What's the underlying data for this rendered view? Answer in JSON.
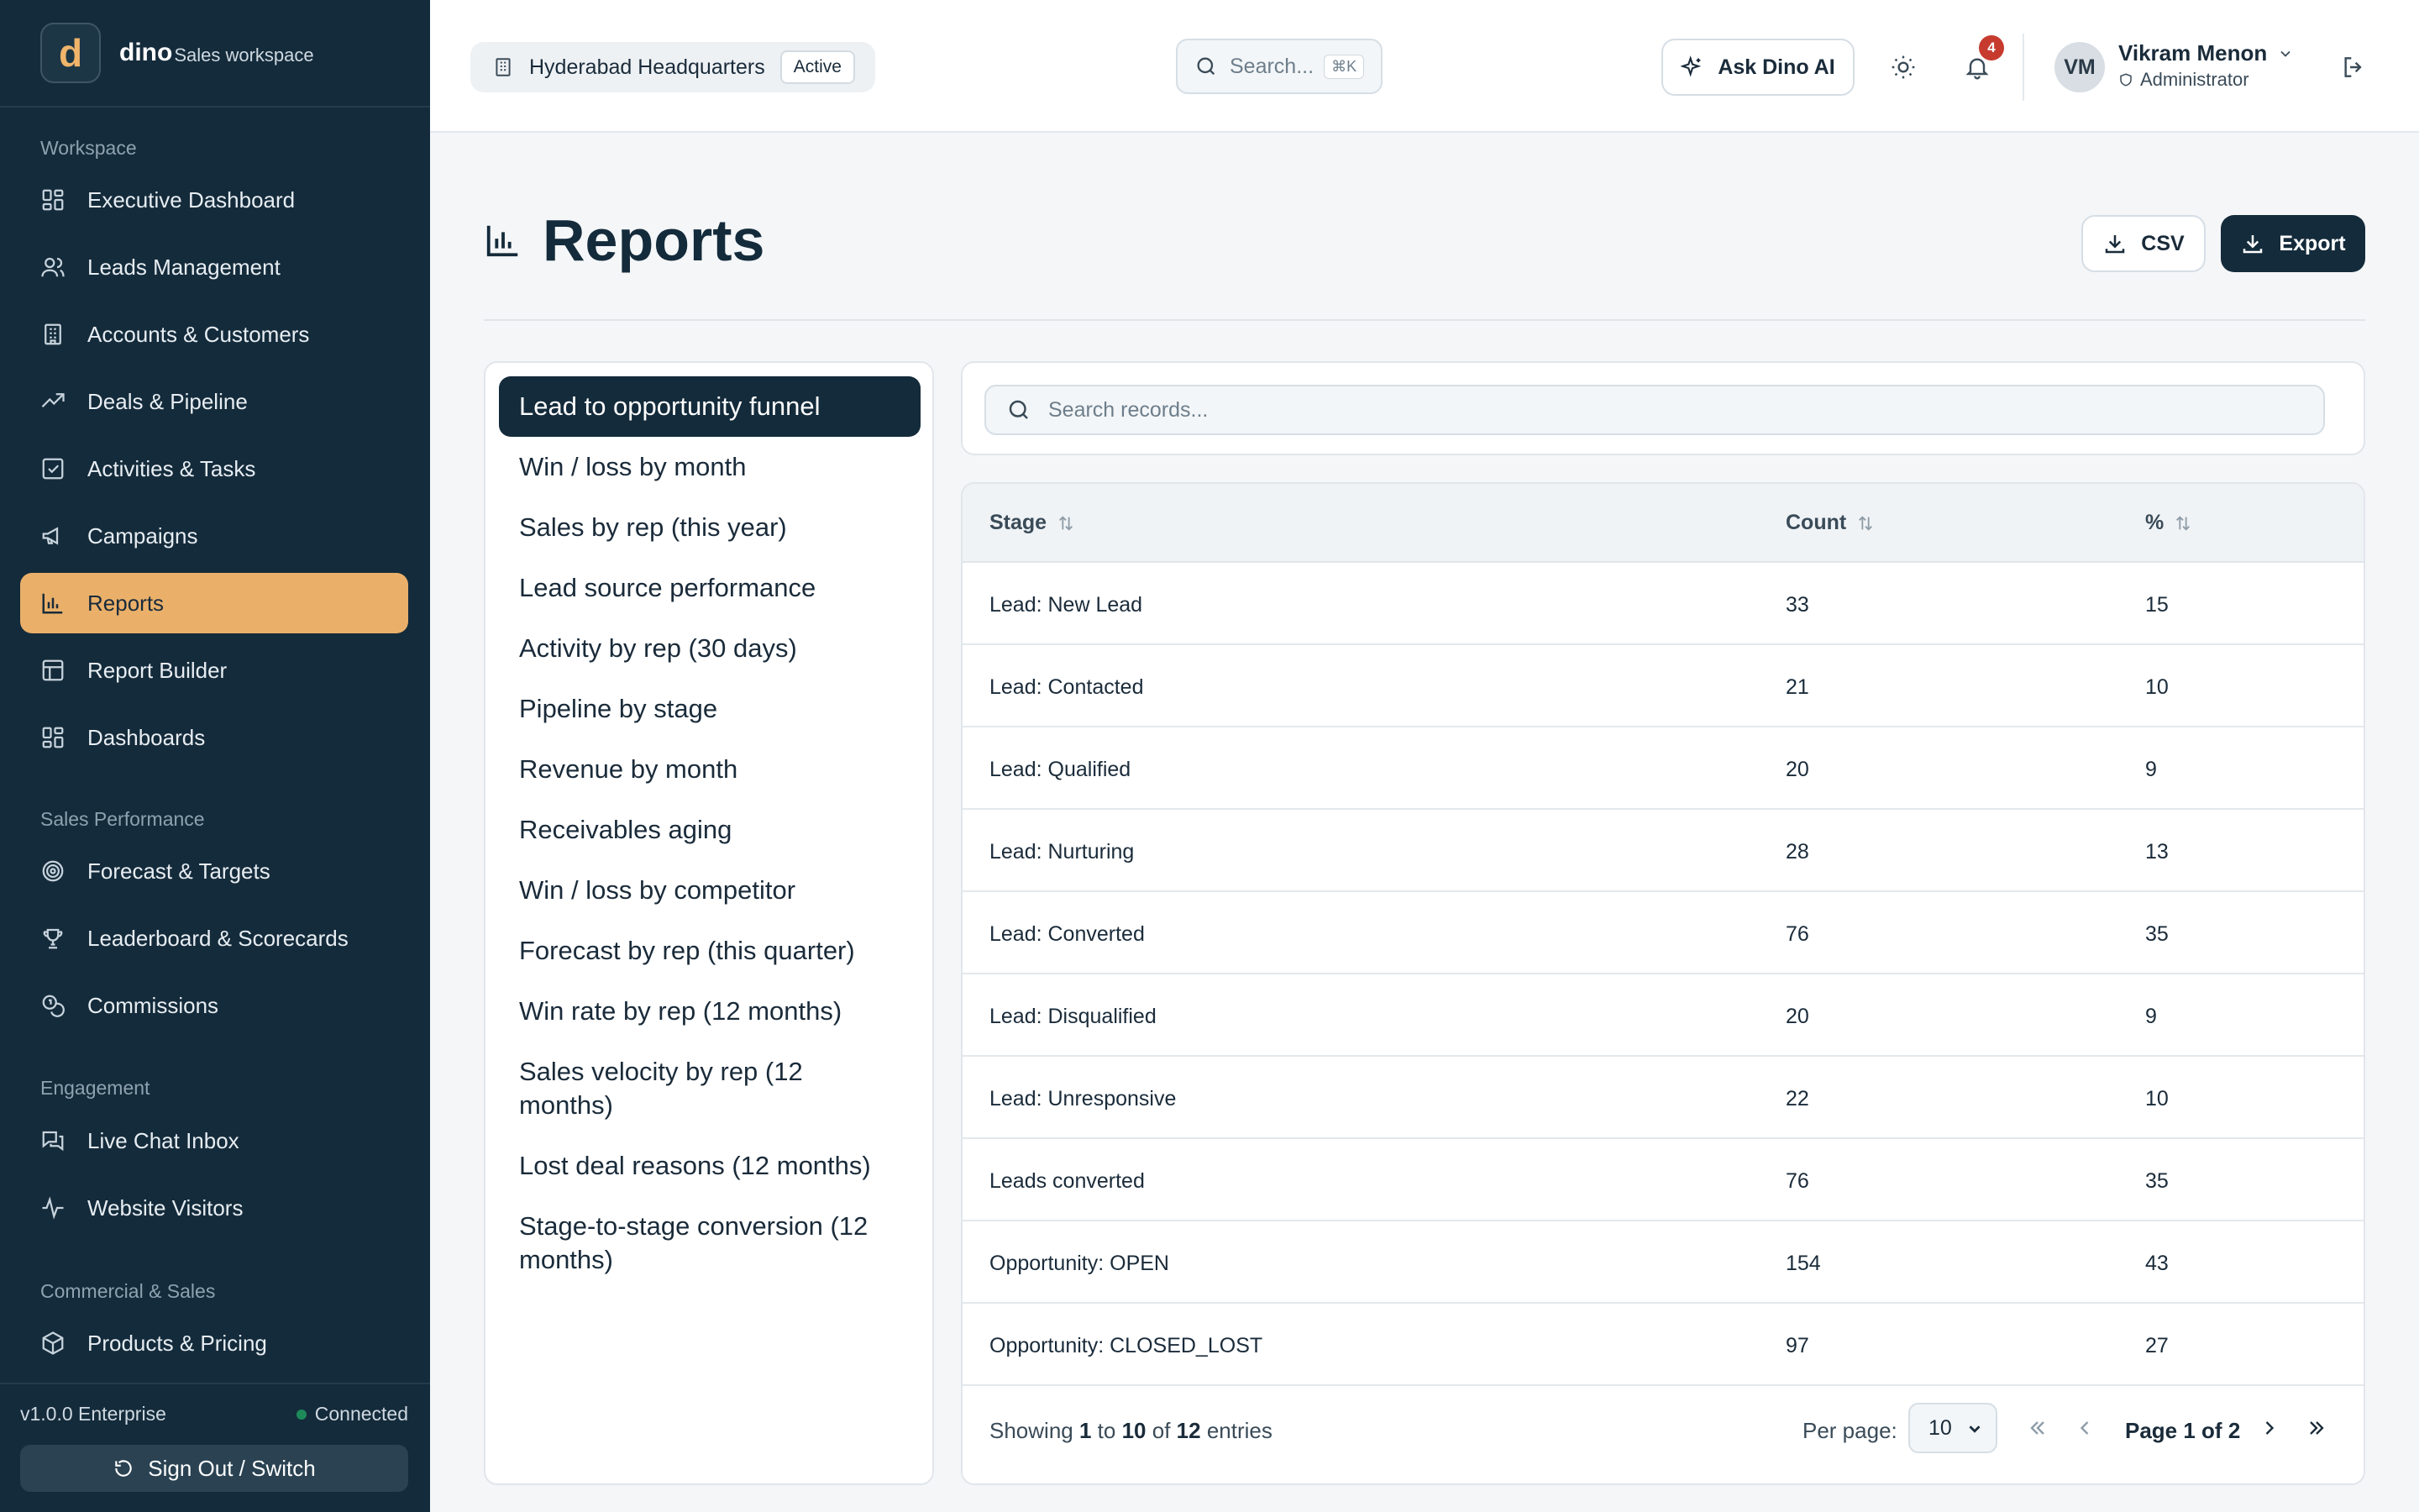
{
  "brand": {
    "logo_letter": "d",
    "name": "dino",
    "subtitle": "Sales workspace"
  },
  "sidebar": {
    "sections": [
      {
        "label": "Workspace"
      },
      {
        "label": "Sales Performance"
      },
      {
        "label": "Engagement"
      },
      {
        "label": "Commercial & Sales"
      }
    ],
    "items": [
      {
        "label": "Executive Dashboard",
        "icon": "dashboard-icon"
      },
      {
        "label": "Leads Management",
        "icon": "users-icon"
      },
      {
        "label": "Accounts & Customers",
        "icon": "building-icon"
      },
      {
        "label": "Deals & Pipeline",
        "icon": "trending-up-icon"
      },
      {
        "label": "Activities & Tasks",
        "icon": "checkbox-icon"
      },
      {
        "label": "Campaigns",
        "icon": "megaphone-icon"
      },
      {
        "label": "Reports",
        "icon": "bar-chart-icon",
        "active": true
      },
      {
        "label": "Report Builder",
        "icon": "table-icon"
      },
      {
        "label": "Dashboards",
        "icon": "dashboard-icon"
      },
      {
        "label": "Forecast & Targets",
        "icon": "target-icon"
      },
      {
        "label": "Leaderboard & Scorecards",
        "icon": "trophy-icon"
      },
      {
        "label": "Commissions",
        "icon": "coins-icon"
      },
      {
        "label": "Live Chat Inbox",
        "icon": "chat-icon"
      },
      {
        "label": "Website Visitors",
        "icon": "activity-icon"
      },
      {
        "label": "Products & Pricing",
        "icon": "package-icon"
      }
    ],
    "version": "v1.0.0 Enterprise",
    "connection": "Connected",
    "sign_out_label": "Sign Out / Switch"
  },
  "topbar": {
    "location": "Hyderabad Headquarters",
    "location_status": "Active",
    "search_placeholder": "Search...",
    "search_shortcut": "⌘K",
    "ask_ai_label": "Ask Dino AI",
    "notification_count": "4",
    "user": {
      "initials": "VM",
      "name": "Vikram Menon",
      "role": "Administrator"
    }
  },
  "page": {
    "title": "Reports",
    "csv_label": "CSV",
    "export_label": "Export"
  },
  "reports_list": [
    {
      "label": "Lead to opportunity funnel",
      "active": true
    },
    {
      "label": "Win / loss by month"
    },
    {
      "label": "Sales by rep (this year)"
    },
    {
      "label": "Lead source performance"
    },
    {
      "label": "Activity by rep (30 days)"
    },
    {
      "label": "Pipeline by stage"
    },
    {
      "label": "Revenue by month"
    },
    {
      "label": "Receivables aging"
    },
    {
      "label": "Win / loss by competitor"
    },
    {
      "label": "Forecast by rep (this quarter)"
    },
    {
      "label": "Win rate by rep (12 months)"
    },
    {
      "label": "Sales velocity by rep (12 months)"
    },
    {
      "label": "Lost deal reasons (12 months)"
    },
    {
      "label": "Stage-to-stage conversion (12 months)"
    }
  ],
  "table": {
    "search_placeholder": "Search records...",
    "columns": [
      "Stage",
      "Count",
      "%"
    ],
    "rows": [
      [
        "Lead: New Lead",
        "33",
        "15"
      ],
      [
        "Lead: Contacted",
        "21",
        "10"
      ],
      [
        "Lead: Qualified",
        "20",
        "9"
      ],
      [
        "Lead: Nurturing",
        "28",
        "13"
      ],
      [
        "Lead: Converted",
        "76",
        "35"
      ],
      [
        "Lead: Disqualified",
        "20",
        "9"
      ],
      [
        "Lead: Unresponsive",
        "22",
        "10"
      ],
      [
        "Leads converted",
        "76",
        "35"
      ],
      [
        "Opportunity: OPEN",
        "154",
        "43"
      ],
      [
        "Opportunity: CLOSED_LOST",
        "97",
        "27"
      ]
    ],
    "footer": {
      "showing_prefix": "Showing",
      "from": "1",
      "to_word": "to",
      "to": "10",
      "of_word": "of",
      "total": "12",
      "entries_word": "entries",
      "per_page_label": "Per page:",
      "per_page_value": "10",
      "page_label": "Page 1 of 2"
    }
  }
}
